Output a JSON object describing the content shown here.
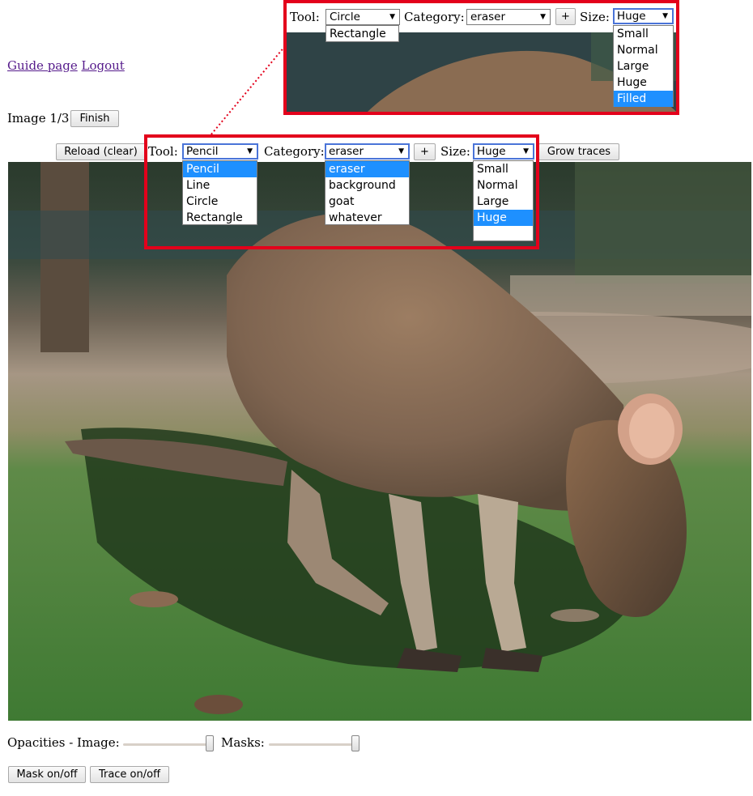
{
  "nav": {
    "guide_link": "Guide page",
    "logout_link": "Logout"
  },
  "progress": {
    "label": "Image 1/3",
    "finish_button": "Finish"
  },
  "toolbar": {
    "reload_button": "Reload (clear)",
    "tool_label": "Tool:",
    "tool_value": "Pencil",
    "tool_options": [
      "Pencil",
      "Line",
      "Circle",
      "Rectangle"
    ],
    "category_label": "Category:",
    "category_value": "eraser",
    "category_options": [
      "eraser",
      "background",
      "goat",
      "whatever"
    ],
    "add_button": "+",
    "size_label": "Size:",
    "size_value": "Huge",
    "size_options": [
      "Small",
      "Normal",
      "Large",
      "Huge"
    ],
    "grow_button": "Grow traces"
  },
  "inset": {
    "tool_label": "Tool:",
    "tool_value": "Circle",
    "tool_options": [
      "Rectangle"
    ],
    "category_label": "Category:",
    "category_value": "eraser",
    "add_button": "+",
    "size_label": "Size:",
    "size_value": "Huge",
    "size_options": [
      "Small",
      "Normal",
      "Large",
      "Huge",
      "Filled"
    ]
  },
  "opacities": {
    "label": "Opacities - Image:",
    "masks_label": "Masks:",
    "image_opacity": 1.0,
    "mask_opacity": 1.0
  },
  "bottom": {
    "mask_button": "Mask on/off",
    "trace_button": "Trace on/off"
  },
  "colors": {
    "highlight": "#1e90ff",
    "callout": "#e3001b",
    "link": "#551a8b"
  },
  "photo": {
    "subject": "wallaby-photo"
  }
}
